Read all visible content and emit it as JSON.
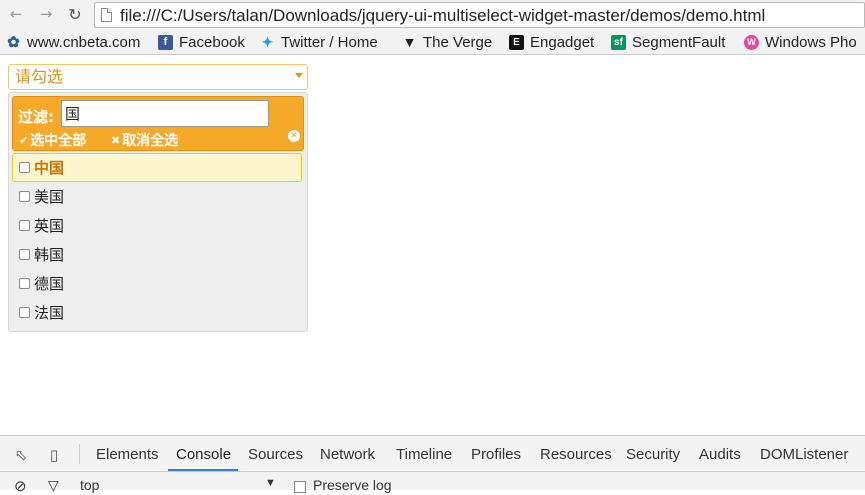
{
  "browser": {
    "url": "file:///C:/Users/talan/Downloads/jquery-ui-multiselect-widget-master/demos/demo.html",
    "bookmarks": [
      {
        "label": "www.cnbeta.com",
        "icon": "cnbeta-icon"
      },
      {
        "label": "Facebook",
        "icon": "facebook-icon"
      },
      {
        "label": "Twitter / Home",
        "icon": "twitter-icon"
      },
      {
        "label": "The Verge",
        "icon": "verge-icon"
      },
      {
        "label": "Engadget",
        "icon": "engadget-icon"
      },
      {
        "label": "SegmentFault",
        "icon": "segmentfault-icon"
      },
      {
        "label": "Windows Pho",
        "icon": "windows-phone-icon"
      }
    ]
  },
  "multiselect": {
    "button_label": "请勾选",
    "filter_label": "过滤:",
    "filter_value": "国",
    "check_all": "选中全部",
    "uncheck_all": "取消全选",
    "options": [
      {
        "label": "中国",
        "checked": false,
        "hovered": true
      },
      {
        "label": "美国",
        "checked": false
      },
      {
        "label": "英国",
        "checked": false
      },
      {
        "label": "韩国",
        "checked": false
      },
      {
        "label": "德国",
        "checked": false
      },
      {
        "label": "法国",
        "checked": false
      }
    ]
  },
  "devtools": {
    "tabs": [
      "Elements",
      "Console",
      "Sources",
      "Network",
      "Timeline",
      "Profiles",
      "Resources",
      "Security",
      "Audits",
      "DOMListener"
    ],
    "active_tab": "Console",
    "context": "top",
    "preserve_log": "Preserve log"
  },
  "colors": {
    "accent": "#f6a828",
    "hover_bg": "#fdf5ce",
    "button_text": "#e0921b"
  }
}
